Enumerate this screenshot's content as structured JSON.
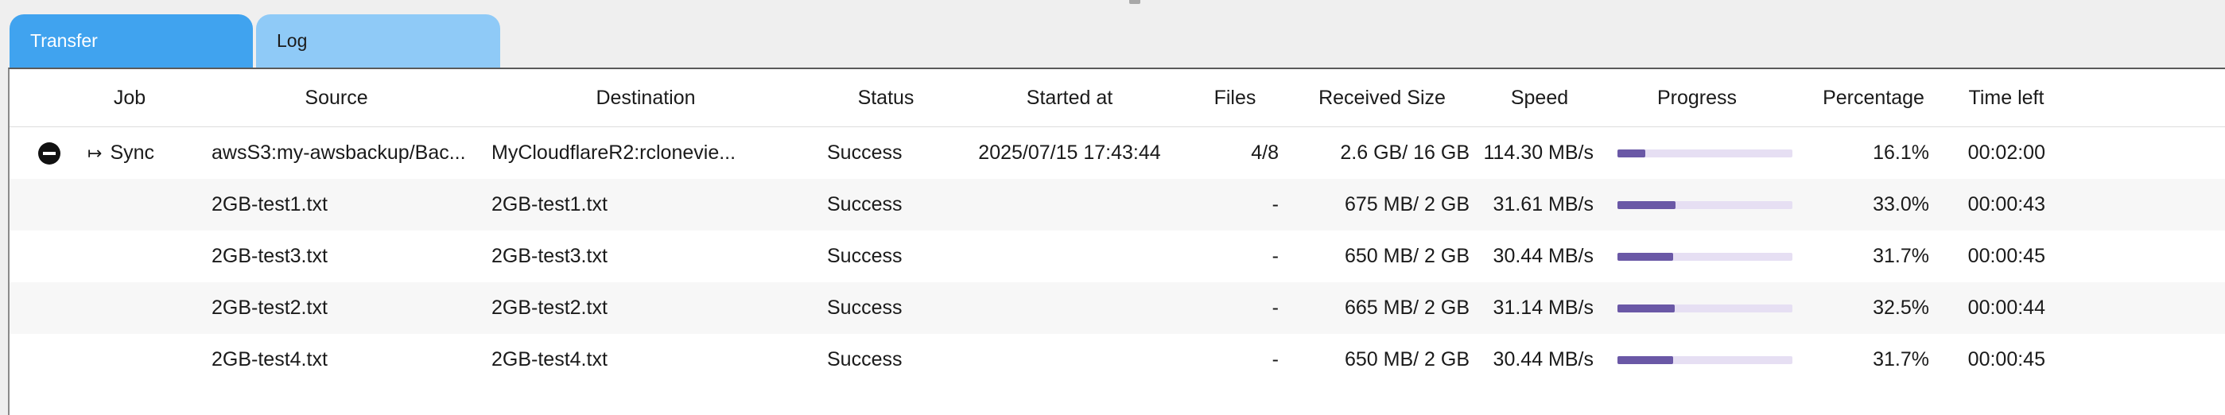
{
  "tabs": [
    {
      "label": "Transfer",
      "active": true
    },
    {
      "label": "Log",
      "active": false
    }
  ],
  "columns": [
    "Job",
    "Source",
    "Destination",
    "Status",
    "Started at",
    "Files",
    "Received Size",
    "Speed",
    "Progress",
    "Percentage",
    "Time left"
  ],
  "colors": {
    "tab_active": "#40a3ef",
    "tab_inactive": "#8fcaf7",
    "progress_fill": "#6a58a6",
    "progress_track": "#e6dff3"
  },
  "rows": [
    {
      "has_remove_button": true,
      "job_icon": "sync-arrow-icon",
      "job": "Sync",
      "source": "awsS3:my-awsbackup/Bac...",
      "destination": "MyCloudflareR2:rclonevie...",
      "status": "Success",
      "started_at": "2025/07/15 17:43:44",
      "files": "4/8",
      "received_size": "2.6 GB/ 16 GB",
      "speed": "114.30 MB/s",
      "progress": 0.161,
      "percentage": "16.1%",
      "time_left": "00:02:00"
    },
    {
      "has_remove_button": false,
      "job_icon": "",
      "job": "",
      "source": "2GB-test1.txt",
      "destination": "2GB-test1.txt",
      "status": "Success",
      "started_at": "",
      "files": "-",
      "received_size": "675 MB/ 2 GB",
      "speed": "31.61 MB/s",
      "progress": 0.33,
      "percentage": "33.0%",
      "time_left": "00:00:43"
    },
    {
      "has_remove_button": false,
      "job_icon": "",
      "job": "",
      "source": "2GB-test3.txt",
      "destination": "2GB-test3.txt",
      "status": "Success",
      "started_at": "",
      "files": "-",
      "received_size": "650 MB/ 2 GB",
      "speed": "30.44 MB/s",
      "progress": 0.317,
      "percentage": "31.7%",
      "time_left": "00:00:45"
    },
    {
      "has_remove_button": false,
      "job_icon": "",
      "job": "",
      "source": "2GB-test2.txt",
      "destination": "2GB-test2.txt",
      "status": "Success",
      "started_at": "",
      "files": "-",
      "received_size": "665 MB/ 2 GB",
      "speed": "31.14 MB/s",
      "progress": 0.325,
      "percentage": "32.5%",
      "time_left": "00:00:44"
    },
    {
      "has_remove_button": false,
      "job_icon": "",
      "job": "",
      "source": "2GB-test4.txt",
      "destination": "2GB-test4.txt",
      "status": "Success",
      "started_at": "",
      "files": "-",
      "received_size": "650 MB/ 2 GB",
      "speed": "30.44 MB/s",
      "progress": 0.317,
      "percentage": "31.7%",
      "time_left": "00:00:45"
    }
  ]
}
